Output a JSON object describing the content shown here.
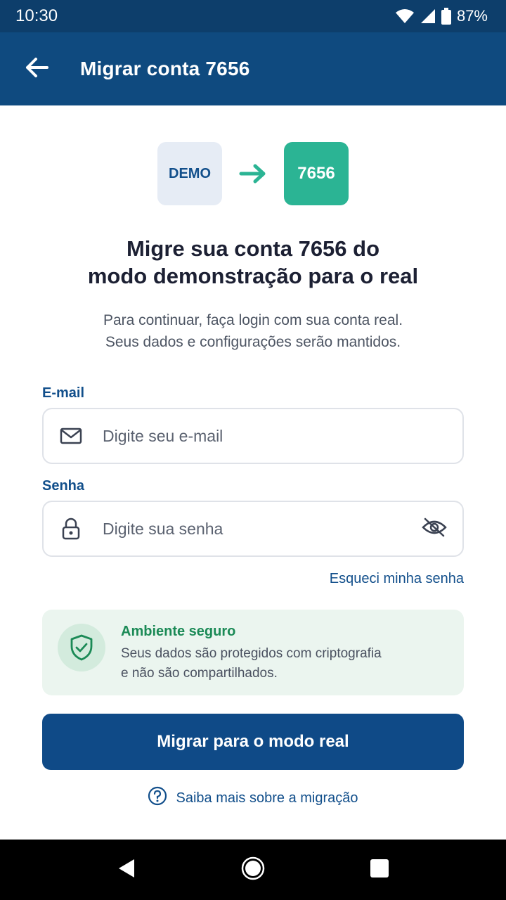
{
  "status_bar": {
    "time": "10:30",
    "battery": "87%"
  },
  "app_bar": {
    "title": "Migrar conta 7656"
  },
  "migration": {
    "from_label": "DEMO",
    "to_label": "7656"
  },
  "headline": {
    "line1": "Migre sua conta 7656 do",
    "line2": "modo demonstração para o real"
  },
  "subtext": {
    "line1": "Para continuar, faça login com sua conta real.",
    "line2": "Seus dados e configurações serão mantidos."
  },
  "form": {
    "email_label": "E-mail",
    "email_placeholder": "Digite seu e-mail",
    "email_value": "",
    "password_label": "Senha",
    "password_placeholder": "Digite sua senha",
    "password_value": "",
    "forgot_link": "Esqueci minha senha"
  },
  "security": {
    "title": "Ambiente seguro",
    "line1": "Seus dados são protegidos com criptografia",
    "line2": "e não são compartilhados."
  },
  "primary_button": "Migrar para o modo real",
  "learn_more": "Saiba mais sobre a migração",
  "icons": {
    "back": "arrow-left-icon",
    "arrow": "arrow-right-icon",
    "email": "mail-icon",
    "password": "lock-icon",
    "toggle": "eye-off-icon",
    "security": "shield-check-icon",
    "help": "help-circle-icon"
  },
  "colors": {
    "app_bar": "#0f4a7f",
    "status_bar": "#0d3e6b",
    "accent_blue": "#124f8b",
    "real_badge": "#2bb494",
    "demo_badge": "#e6ecf5",
    "secure_bg": "#ebf5ef",
    "secure_title": "#1b8a56",
    "primary_button": "#0f4a87"
  }
}
